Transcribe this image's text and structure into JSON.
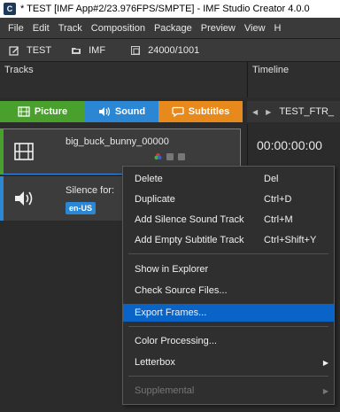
{
  "window": {
    "title": "* TEST [IMF App#2/23.976FPS/SMPTE] - IMF Studio Creator 4.0.0",
    "app_icon": "C"
  },
  "menubar": {
    "items": [
      "File",
      "Edit",
      "Track",
      "Composition",
      "Package",
      "Preview",
      "View",
      "H"
    ]
  },
  "toolbar": {
    "project": "TEST",
    "type": "IMF",
    "framerate": "24000/1001"
  },
  "tracks_panel": {
    "title": "Tracks",
    "tabs": [
      {
        "label": "Picture",
        "color": "#4aa02c",
        "icon": "film-icon"
      },
      {
        "label": "Sound",
        "color": "#2b86d4",
        "icon": "speaker-icon"
      },
      {
        "label": "Subtitles",
        "color": "#e8891c",
        "icon": "speech-bubble-icon"
      }
    ],
    "tracks": [
      {
        "name": "big_buck_bunny_00000",
        "type": "video"
      },
      {
        "name": "Silence for:",
        "type": "audio",
        "language": "en-US"
      }
    ]
  },
  "timeline_panel": {
    "title": "Timeline",
    "composition": "TEST_FTR_",
    "timecode": "00:00:00:00"
  },
  "context_menu": {
    "items": [
      {
        "label": "Delete",
        "shortcut": "Del"
      },
      {
        "label": "Duplicate",
        "shortcut": "Ctrl+D"
      },
      {
        "label": "Add Silence Sound Track",
        "shortcut": "Ctrl+M"
      },
      {
        "label": "Add Empty Subtitle Track",
        "shortcut": "Ctrl+Shift+Y"
      },
      {
        "label": "Show in Explorer"
      },
      {
        "label": "Check Source Files..."
      },
      {
        "label": "Export Frames...",
        "active": true
      },
      {
        "label": "Color Processing..."
      },
      {
        "label": "Letterbox",
        "submenu": true
      },
      {
        "label": "Supplemental",
        "submenu": true,
        "disabled": true
      }
    ]
  },
  "colors": {
    "accent": "#0a64c8",
    "picture": "#4aa02c",
    "sound": "#2b86d4",
    "subtitles": "#e8891c"
  }
}
